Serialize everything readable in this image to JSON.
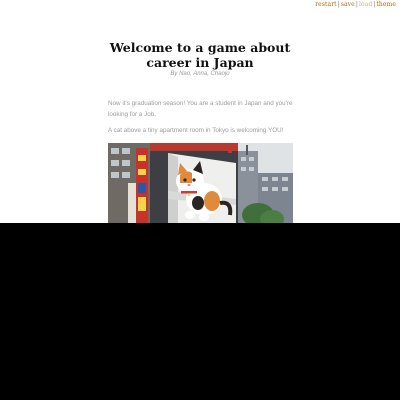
{
  "menu": {
    "restart": "restart",
    "save": "save",
    "load": "load",
    "theme": "theme",
    "separator": "|"
  },
  "header": {
    "title": "Welcome to a game about career in Japan",
    "byline": "By Nao, Anna, Chaojo"
  },
  "story": {
    "paragraphs": [
      "Now it's graduation season! You are a student in Japan and you're looking for a Job.",
      "A cat above a tiny apartment room in Tokyo is welcoming YOU!"
    ]
  },
  "image": {
    "subject": "giant-3d-cat-billboard",
    "colors": {
      "sky": "#dfe3e6",
      "billboard": "#e9e9ea",
      "cat_white": "#ffffff",
      "cat_orange": "#e08a3c",
      "cat_dark": "#2a2522",
      "building": "#7d8590",
      "tree": "#3f6f3a"
    }
  },
  "colors": {
    "link": "#a56a12",
    "link_disabled": "#c9b38f",
    "title": "#111111",
    "text": "#9c9c9c",
    "byline": "#9a9a9a",
    "overlay": "#000000"
  }
}
